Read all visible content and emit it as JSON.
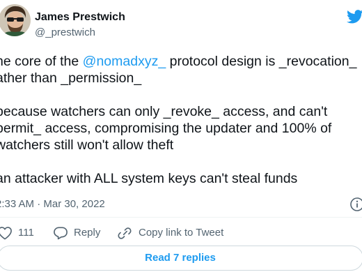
{
  "author": {
    "display_name": "James Prestwich",
    "handle": "@_prestwich"
  },
  "tweet": {
    "line1_text": "he core of the ",
    "line1_mention": "@nomadxyz_",
    "line1_rest": " protocol design is _revocation_",
    "line2": "ather than _permission_",
    "para2_line1": "because watchers can only _revoke_ access, and can't",
    "para2_line2": "permit_ access, compromising the updater and 100% of",
    "para2_line3": "watchers still won't allow theft",
    "para3_line1": "an attacker with ALL system keys can't steal funds"
  },
  "meta": {
    "timestamp": "2:33 AM · Mar 30, 2022"
  },
  "actions": {
    "like_count": "111",
    "reply_label": "Reply",
    "copy_link_label": "Copy link to Tweet"
  },
  "read_replies_label": "Read 7 replies",
  "colors": {
    "accent": "#1d9bf0",
    "like_red": "#f91880",
    "secondary_text": "#536471",
    "border": "#cfd9de"
  },
  "icons": [
    "avatar",
    "twitter-bird-icon",
    "info-icon",
    "heart-icon",
    "reply-bubble-icon",
    "link-icon"
  ]
}
